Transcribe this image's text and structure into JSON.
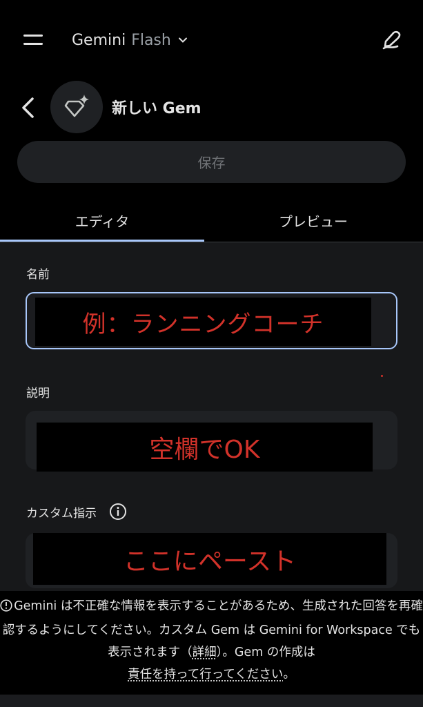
{
  "topbar": {
    "app_name": "Gemini",
    "model_name": "Flash"
  },
  "header": {
    "title": "新しい Gem",
    "save_label": "保存"
  },
  "tabs": [
    {
      "label": "エディタ",
      "active": true
    },
    {
      "label": "プレビュー",
      "active": false
    }
  ],
  "form": {
    "name_label": "名前",
    "name_overlay": "例：ランニングコーチ",
    "description_label": "説明",
    "description_overlay": "空欄でOK",
    "instructions_label": "カスタム指示",
    "instructions_overlay": "ここにペースト"
  },
  "disclaimer": {
    "part1": "Gemini は不正確な情報を表示することがあるため、生成された回答を再確認するようにしてください。カスタム Gem は Gemini for Workspace でも表示されます（",
    "details_link": "詳細",
    "part2": "）。Gem の作成は",
    "responsibility_link": "責任を持って行ってください",
    "part3": "。"
  },
  "colors": {
    "accent": "#a8c7fa",
    "overlay_text": "#d2322a",
    "panel_bg": "#17181a"
  }
}
